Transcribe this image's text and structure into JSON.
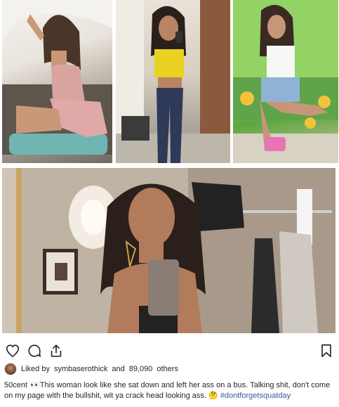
{
  "images": {
    "collage": {
      "photo_count": 3
    },
    "selfie": {}
  },
  "actions": {
    "like_icon": "heart-outline-icon",
    "comment_icon": "comment-bubble-icon",
    "share_icon": "share-upload-icon",
    "save_icon": "bookmark-icon"
  },
  "likes": {
    "prefix": "Liked by",
    "user": "symbaserothick",
    "connector": "and",
    "count": "89,090",
    "suffix": "others"
  },
  "caption": {
    "username": "50cent",
    "emoji_start": "👀",
    "text": "This woman look like she sat down and left her ass on a bus. Talking shit, don't come on my page with the bullshit, wit ya crack head looking ass.",
    "emoji_end": "🤔",
    "hashtag": "#dontforgetsquatday"
  },
  "colors": {
    "text": "#262626",
    "hashtag": "#385898",
    "background": "#ffffff"
  }
}
